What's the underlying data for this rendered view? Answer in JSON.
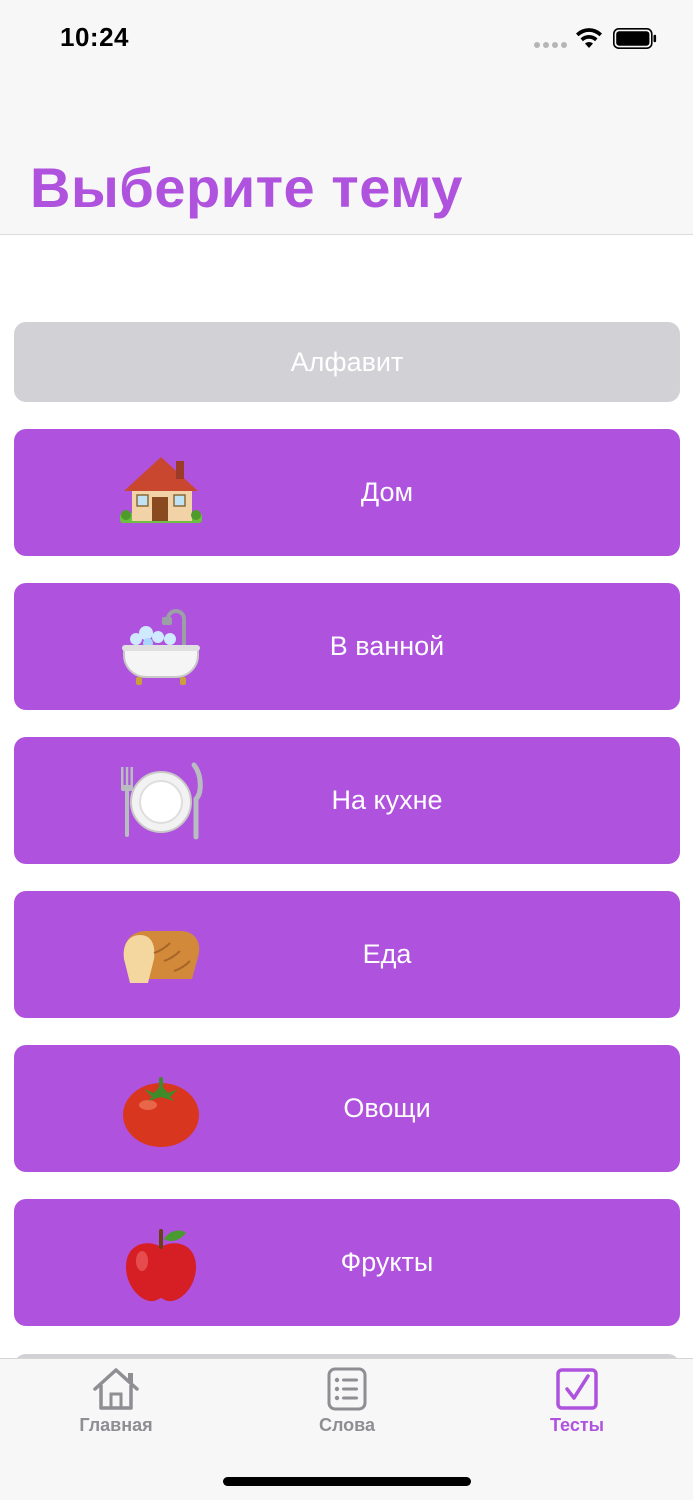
{
  "status_bar": {
    "time": "10:24"
  },
  "header": {
    "title": "Выберите тему"
  },
  "topics": {
    "alphabet": "Алфавит",
    "items": [
      {
        "label": "Дом",
        "icon": "house-icon"
      },
      {
        "label": "В ванной",
        "icon": "bathtub-icon"
      },
      {
        "label": "На кухне",
        "icon": "plate-cutlery-icon"
      },
      {
        "label": "Еда",
        "icon": "bread-icon"
      },
      {
        "label": "Овощи",
        "icon": "tomato-icon"
      },
      {
        "label": "Фрукты",
        "icon": "apple-icon"
      }
    ]
  },
  "tab_bar": {
    "tabs": [
      {
        "label": "Главная",
        "icon": "house-outline-icon",
        "active": false
      },
      {
        "label": "Слова",
        "icon": "list-icon",
        "active": false
      },
      {
        "label": "Тесты",
        "icon": "checkbox-icon",
        "active": true
      }
    ]
  },
  "colors": {
    "accent": "#af52de",
    "inactive_button": "#d1d1d6",
    "tab_inactive": "#8e8e93"
  }
}
